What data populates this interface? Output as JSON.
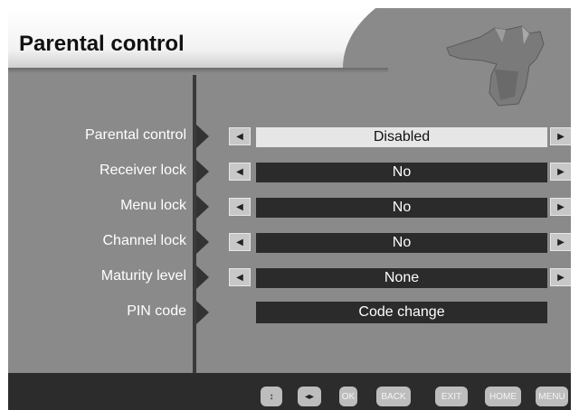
{
  "header": {
    "title": "Parental control"
  },
  "rows": [
    {
      "label": "Parental control",
      "value": "Disabled",
      "selected": true,
      "has_arrows": true
    },
    {
      "label": "Receiver lock",
      "value": "No",
      "selected": false,
      "has_arrows": true
    },
    {
      "label": "Menu lock",
      "value": "No",
      "selected": false,
      "has_arrows": true
    },
    {
      "label": "Channel lock",
      "value": "No",
      "selected": false,
      "has_arrows": true
    },
    {
      "label": "Maturity level",
      "value": "None",
      "selected": false,
      "has_arrows": true
    },
    {
      "label": "PIN code",
      "value": "Code change",
      "selected": false,
      "has_arrows": false
    }
  ],
  "footer": {
    "buttons": [
      {
        "name": "updown-key",
        "label": "↕"
      },
      {
        "name": "leftright-key",
        "label": "◂▸"
      },
      {
        "name": "ok-key",
        "label": "OK"
      },
      {
        "name": "back-key",
        "label": "BACK"
      },
      {
        "name": "exit-key",
        "label": "EXIT"
      },
      {
        "name": "home-key",
        "label": "HOME"
      },
      {
        "name": "menu-key",
        "label": "MENU"
      }
    ]
  },
  "colors": {
    "background": "#8a8a8a",
    "selected_value_bg": "#e6e6e6",
    "value_bg": "#2b2b2b",
    "footer_bg": "#2c2c2c"
  },
  "icons": {
    "arrow_left": "◀",
    "arrow_right": "▶"
  }
}
